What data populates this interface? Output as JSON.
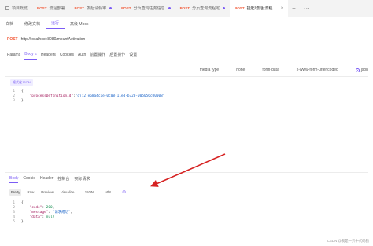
{
  "tabs": [
    {
      "method": "",
      "label": "项目概览",
      "dot": false
    },
    {
      "method": "POST",
      "label": "流程部署",
      "dot": false
    },
    {
      "method": "POST",
      "label": "发起请假审",
      "dot": true
    },
    {
      "method": "POST",
      "label": "分页查询任务信息",
      "dot": true
    },
    {
      "method": "POST",
      "label": "分页查询流程定",
      "dot": true
    },
    {
      "method": "POST",
      "label": "挂起/激活 流程...",
      "dot": false,
      "active": true
    }
  ],
  "tabbar_extra": {
    "plus": "+",
    "more": "···"
  },
  "subtabs": [
    "文档",
    "修改文档",
    "运行",
    "高级 Mock"
  ],
  "request": {
    "method": "POST",
    "url": "http://localhost:8080/mountActivation"
  },
  "request_tabs": [
    {
      "label": "Params"
    },
    {
      "label": "Body",
      "badge": "1",
      "active": true
    },
    {
      "label": "Headers"
    },
    {
      "label": "Cookies"
    },
    {
      "label": "Auth"
    },
    {
      "label": "前置操作"
    },
    {
      "label": "后置操作"
    },
    {
      "label": "设置"
    }
  ],
  "body_types": [
    "media type",
    "none",
    "form-data",
    "x-www-form-urlencoded",
    "json"
  ],
  "format_button": "格式化JSON",
  "request_body": [
    {
      "n": "1",
      "text": "{"
    },
    {
      "n": "2",
      "key": "\"processDefinitionId\"",
      "sep": ":",
      "value": "\"qj:2:e68a4c1e-0c08-11ed-b720-005056c00008\""
    },
    {
      "n": "3",
      "text": "}"
    }
  ],
  "response_tabs": [
    {
      "label": "Body",
      "active": true
    },
    {
      "label": "Cookie"
    },
    {
      "label": "Header"
    },
    {
      "label": "控制台"
    },
    {
      "label": "实际请求"
    }
  ],
  "response_tools": {
    "modes": [
      "Pretty",
      "Raw",
      "Preview",
      "Visualize"
    ],
    "format": "JSON",
    "encoding": "utf8",
    "chevron": "⌄",
    "icon": "⊜"
  },
  "response_body": [
    {
      "n": "1",
      "text": "{"
    },
    {
      "n": "2",
      "key": "\"code\"",
      "value": "200",
      "type": "num"
    },
    {
      "n": "3",
      "key": "\"message\"",
      "value": "\"请求成功\"",
      "type": "str"
    },
    {
      "n": "4",
      "key": "\"data\"",
      "value": "null",
      "type": "num",
      "last": true
    },
    {
      "n": "5",
      "text": "}"
    }
  ],
  "watermark": "CSDN @我是一只中代码狗",
  "colors": {
    "accent": "#7b5cf5",
    "method": "#f25c3b",
    "arrow": "#d62222"
  }
}
